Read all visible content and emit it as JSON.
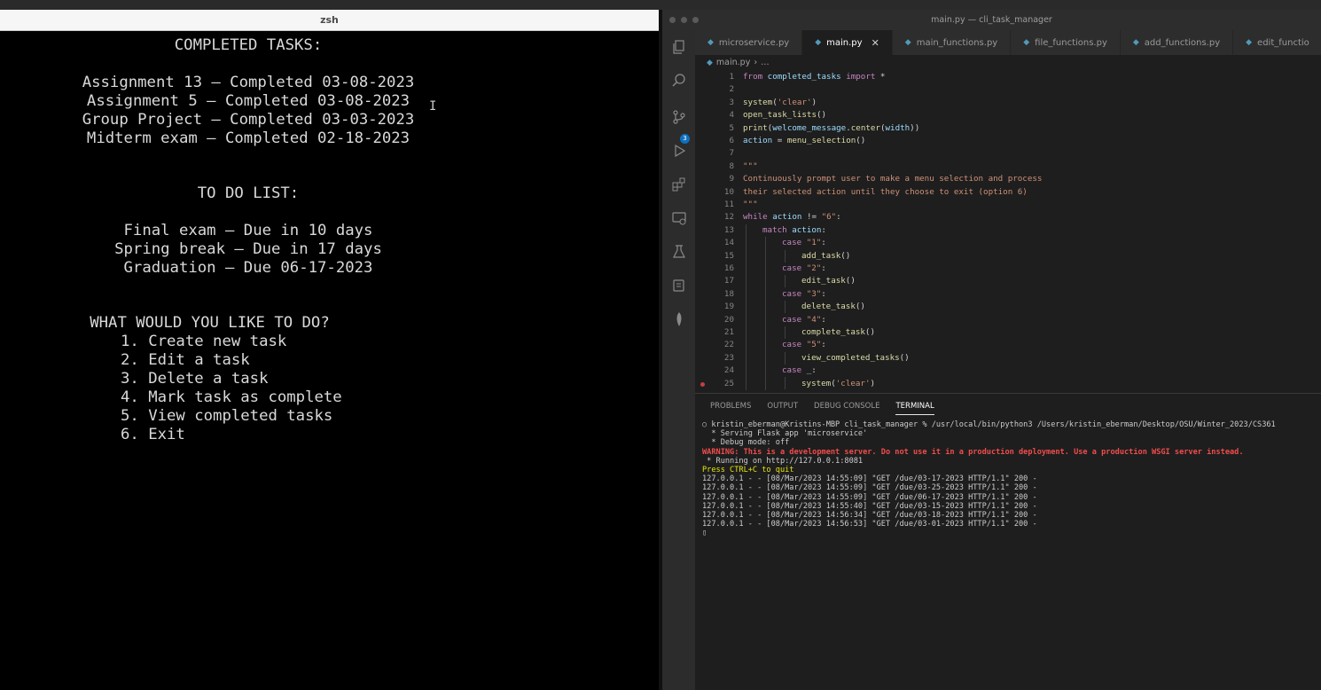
{
  "left_terminal": {
    "title": "zsh",
    "completed_header": "COMPLETED TASKS:",
    "completed": [
      "Assignment 13 — Completed 03-08-2023",
      "Assignment 5 — Completed 03-08-2023",
      "Group Project — Completed 03-03-2023",
      "Midterm exam — Completed 02-18-2023"
    ],
    "todo_header": "TO DO LIST:",
    "todo": [
      "Final exam — Due in 10 days",
      "Spring break — Due in 17 days",
      "Graduation — Due 06-17-2023"
    ],
    "menu_header": "WHAT WOULD YOU LIKE TO DO?",
    "menu": [
      "1. Create new task",
      "2. Edit a task",
      "3. Delete a task",
      "4. Mark task as complete",
      "5. View completed tasks",
      "6. Exit"
    ]
  },
  "vscode": {
    "window_title": "main.py — cli_task_manager",
    "activity_badge": "3",
    "tabs": [
      "microservice.py",
      "main.py",
      "main_functions.py",
      "file_functions.py",
      "add_functions.py",
      "edit_functio"
    ],
    "breadcrumb_file": "main.py",
    "breadcrumb_more": "…",
    "line_numbers": [
      "1",
      "2",
      "3",
      "4",
      "5",
      "6",
      "7",
      "8",
      "9",
      "10",
      "11",
      "12",
      "13",
      "14",
      "15",
      "16",
      "17",
      "18",
      "19",
      "20",
      "21",
      "22",
      "23",
      "24",
      "25"
    ],
    "code": {
      "l1": {
        "kw": "from",
        "mod": " completed_tasks ",
        "kw2": "import",
        "rest": " *"
      },
      "l3": {
        "fn": "system",
        "p1": "(",
        "str": "'clear'",
        "p2": ")"
      },
      "l4": {
        "fn": "open_task_lists",
        "p": "()"
      },
      "l5": {
        "fn": "print",
        "p1": "(",
        "var": "welcome_message",
        "dot": ".",
        "fn2": "center",
        "p2": "(",
        "var2": "width",
        "p3": "))"
      },
      "l6": {
        "var": "action",
        "op": " = ",
        "fn": "menu_selection",
        "p": "()"
      },
      "l8": "\"\"\"",
      "l9": "Continuously prompt user to make a menu selection and process",
      "l10": "their selected action until they choose to exit (option 6)",
      "l11": "\"\"\"",
      "l12": {
        "kw": "while",
        "sp": " ",
        "var": "action",
        "op": " != ",
        "str": "\"6\"",
        "end": ":"
      },
      "l13": {
        "kw": "match",
        "sp": " ",
        "var": "action",
        "end": ":"
      },
      "case_kw": "case",
      "cases": [
        "\"1\"",
        "\"2\"",
        "\"3\"",
        "\"4\"",
        "\"5\"",
        "_"
      ],
      "calls": [
        "add_task",
        "edit_task",
        "delete_task",
        "complete_task",
        "view_completed_tasks"
      ],
      "l25": {
        "fn": "system",
        "p1": "(",
        "str": "'clear'",
        "p2": ")"
      },
      "colon": ":",
      "parens": "()"
    },
    "panel_tabs": [
      "PROBLEMS",
      "OUTPUT",
      "DEBUG CONSOLE",
      "TERMINAL"
    ],
    "terminal_lines": [
      "○ kristin_eberman@Kristins-MBP cli_task_manager % /usr/local/bin/python3 /Users/kristin_eberman/Desktop/OSU/Winter_2023/CS361",
      "  * Serving Flask app 'microservice'",
      "  * Debug mode: off"
    ],
    "terminal_warning": "WARNING: This is a development server. Do not use it in a production deployment. Use a production WSGI server instead.",
    "terminal_running": " * Running on http://127.0.0.1:8081",
    "terminal_quit": "Press CTRL+C to quit",
    "terminal_logs": [
      "127.0.0.1 - - [08/Mar/2023 14:55:09] \"GET /due/03-17-2023 HTTP/1.1\" 200 -",
      "127.0.0.1 - - [08/Mar/2023 14:55:09] \"GET /due/03-25-2023 HTTP/1.1\" 200 -",
      "127.0.0.1 - - [08/Mar/2023 14:55:09] \"GET /due/06-17-2023 HTTP/1.1\" 200 -",
      "127.0.0.1 - - [08/Mar/2023 14:55:40] \"GET /due/03-15-2023 HTTP/1.1\" 200 -",
      "127.0.0.1 - - [08/Mar/2023 14:56:34] \"GET /due/03-18-2023 HTTP/1.1\" 200 -",
      "127.0.0.1 - - [08/Mar/2023 14:56:53] \"GET /due/03-01-2023 HTTP/1.1\" 200 -"
    ],
    "terminal_cursor": "▯"
  },
  "colors": {
    "terminal_bg": "#000000",
    "editor_bg": "#1e1e1e",
    "keyword": "#c586c0",
    "function": "#dcdcaa",
    "string": "#ce9178",
    "variable": "#9cdcfe",
    "warning": "#f14c4c",
    "prompt_yellow": "#e5e510"
  },
  "icons": [
    "files-icon",
    "search-icon",
    "source-control-icon",
    "run-debug-icon",
    "extensions-icon",
    "remote-explorer-icon",
    "testing-icon",
    "docker-icon",
    "mongodb-icon",
    "python-file-icon",
    "close-icon",
    "breakpoint-icon"
  ]
}
